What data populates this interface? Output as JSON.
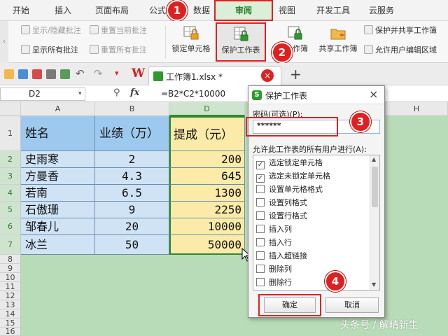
{
  "menu": {
    "items": [
      "开始",
      "插入",
      "页面布局",
      "公式",
      "数据",
      "审阅",
      "视图",
      "开发工具",
      "云服务"
    ],
    "active": "审阅"
  },
  "ribbon": {
    "show_hide_comments": "显示/隐藏批注",
    "reset_current_comment": "重置当前批注",
    "show_all_comments": "显示所有批注",
    "reset_all_comments": "重置所有批注",
    "lock_cells": "锁定单元格",
    "protect_sheet": "保护工作表",
    "protect_workbook_partial": "作簿",
    "share_workbook": "共享工作簿",
    "protect_and_share": "保护并共享工作簿",
    "allow_edit_ranges": "允许用户编辑区域"
  },
  "tab": {
    "title": "工作簿1.xlsx *",
    "add_label": "+"
  },
  "formula_bar": {
    "name_box": "D2",
    "fx_label": "fx",
    "formula": "=B2*C2*10000"
  },
  "grid": {
    "columns": [
      "A",
      "B",
      "D",
      "H"
    ],
    "rows": [
      "1",
      "2",
      "3",
      "4",
      "5",
      "6",
      "7",
      "8",
      "9",
      "10",
      "11",
      "12",
      "13",
      "14",
      "15",
      "16"
    ],
    "header": {
      "name": "姓名",
      "score": "业绩（万）",
      "commission": "提成（元）"
    },
    "data": [
      {
        "name": "史雨寒",
        "score": "2",
        "commission": "200"
      },
      {
        "name": "方曼香",
        "score": "4.3",
        "commission": "645"
      },
      {
        "name": "若南",
        "score": "6.5",
        "commission": "1300"
      },
      {
        "name": "石傲珊",
        "score": "9",
        "commission": "2250"
      },
      {
        "name": "邹春儿",
        "score": "20",
        "commission": "10000"
      },
      {
        "name": "冰兰",
        "score": "50",
        "commission": "50000"
      }
    ]
  },
  "dialog": {
    "title": "保护工作表",
    "close": "×",
    "password_label": "密码(可选)(P):",
    "password_value": "******",
    "allow_label": "允许此工作表的所有用户进行(A):",
    "options": [
      {
        "label": "选定锁定单元格",
        "checked": true
      },
      {
        "label": "选定未锁定单元格",
        "checked": true
      },
      {
        "label": "设置单元格格式",
        "checked": false
      },
      {
        "label": "设置列格式",
        "checked": false
      },
      {
        "label": "设置行格式",
        "checked": false
      },
      {
        "label": "插入列",
        "checked": false
      },
      {
        "label": "插入行",
        "checked": false
      },
      {
        "label": "插入超链接",
        "checked": false
      },
      {
        "label": "删除列",
        "checked": false
      },
      {
        "label": "删除行",
        "checked": false
      }
    ],
    "ok": "确定",
    "cancel": "取消"
  },
  "badges": [
    "1",
    "2",
    "3",
    "4"
  ],
  "watermark": "头条号 / 解晴新生",
  "colors": {
    "accent_green": "#2e8b2e",
    "highlight_red": "#e02020",
    "header_blue": "#9ec9ee",
    "cell_blue": "#cfe3f5",
    "cell_yellow": "#fbeaa8",
    "sheet_bg": "#b9dcb8"
  }
}
